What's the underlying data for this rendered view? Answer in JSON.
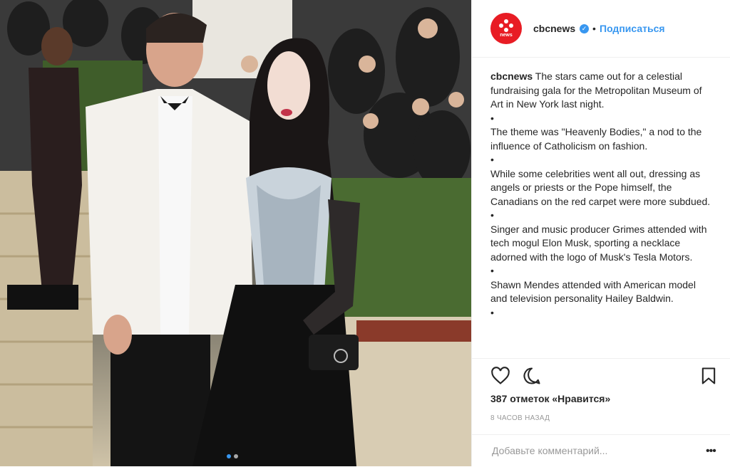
{
  "post": {
    "photo_alt": "Photo",
    "carousel": {
      "count": 2,
      "active": 0
    }
  },
  "header": {
    "avatar_text": "news",
    "username": "cbcnews",
    "verified_mark": "✓",
    "separator": "•",
    "follow_label": "Подписаться"
  },
  "caption": {
    "username": "cbcnews",
    "first": "The stars came out for a celestial fundraising gala for the Metropolitan Museum of Art in New York last night.",
    "bullet": "•",
    "p2": "The theme was \"Heavenly Bodies,\" a nod to the influence of Catholicism on fashion.",
    "p3": "While some celebrities went all out, dressing as angels or priests or the Pope himself, the Canadians on the red carpet were more subdued.",
    "p4": "Singer and music producer Grimes attended with tech mogul Elon Musk, sporting a necklace adorned with the logo of Musk's Tesla Motors.",
    "p5": "Shawn Mendes attended with American model and television personality Hailey Baldwin."
  },
  "actions": {
    "like_icon": "heart-icon",
    "comment_icon": "comment-icon",
    "save_icon": "bookmark-icon"
  },
  "likes_text": "387 отметок «Нравится»",
  "timestamp": "8 ЧАСОВ НАЗАД",
  "comment": {
    "placeholder": "Добавьте комментарий...",
    "more_label": "•••"
  },
  "colors": {
    "accent": "#3897f0",
    "brand": "#e81c24",
    "border": "#efefef",
    "muted": "#999999"
  }
}
